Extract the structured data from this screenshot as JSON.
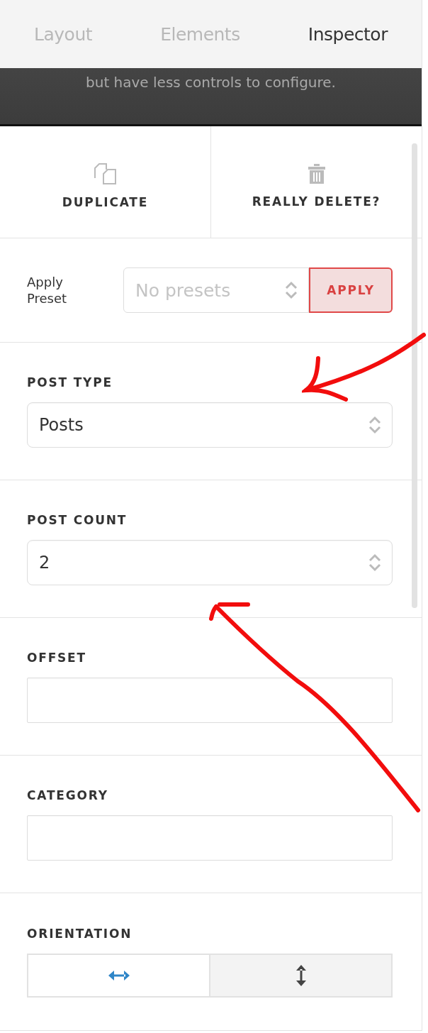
{
  "tabs": [
    {
      "label": "Layout",
      "selected": false
    },
    {
      "label": "Elements",
      "selected": false
    },
    {
      "label": "Inspector",
      "selected": true
    }
  ],
  "banner": {
    "text": "but have less controls to configure."
  },
  "actions": [
    {
      "label": "DUPLICATE",
      "kind": "duplicate"
    },
    {
      "label": "REALLY DELETE?",
      "kind": "delete"
    }
  ],
  "preset": {
    "label": "Apply Preset",
    "placeholder": "No presets",
    "button": "APPLY"
  },
  "sections": [
    {
      "label": "POST TYPE",
      "kind": "select",
      "value": "Posts"
    },
    {
      "label": "POST COUNT",
      "kind": "select",
      "value": "2"
    },
    {
      "label": "OFFSET",
      "kind": "text"
    },
    {
      "label": "CATEGORY",
      "kind": "text"
    },
    {
      "label": "ORIENTATION",
      "kind": "toggle",
      "options": [
        {
          "kind": "horizontal",
          "selected": true
        },
        {
          "kind": "vertical",
          "selected": false
        }
      ]
    }
  ]
}
